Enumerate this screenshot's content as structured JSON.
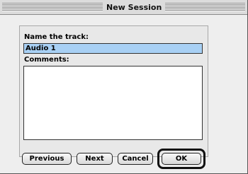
{
  "window": {
    "title": "New Session"
  },
  "form": {
    "track_label": "Name the track:",
    "track_value": "Audio 1",
    "comments_label": "Comments:",
    "comments_value": ""
  },
  "buttons": {
    "previous": "Previous",
    "next": "Next",
    "cancel": "Cancel",
    "ok": "OK"
  }
}
